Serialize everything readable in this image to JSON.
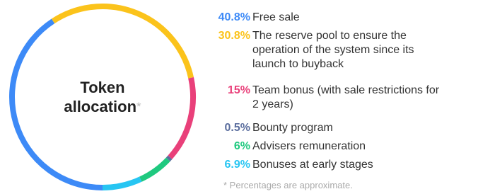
{
  "chart_data": {
    "type": "pie",
    "title": "Token allocation",
    "title_mark": "*",
    "slices": [
      {
        "value": 40.8,
        "label": "40.8%",
        "name": "Free sale",
        "color": "#3d8af7"
      },
      {
        "value": 30.8,
        "label": "30.8%",
        "name": "The reserve pool to ensure the operation of the system since its launch to buyback",
        "color": "#fbc31b"
      },
      {
        "value": 15,
        "label": "15%",
        "name": "Team bonus (with sale restrictions for 2 years)",
        "color": "#e9407a"
      },
      {
        "value": 0.5,
        "label": "0.5%",
        "name": "Bounty program",
        "color": "#5b6e9e"
      },
      {
        "value": 6,
        "label": "6%",
        "name": "Advisers remuneration",
        "color": "#1fc97f"
      },
      {
        "value": 6.9,
        "label": "6.9%",
        "name": "Bonuses at early stages",
        "color": "#27c5f2"
      }
    ],
    "footnote": "* Percentages are approximate."
  }
}
